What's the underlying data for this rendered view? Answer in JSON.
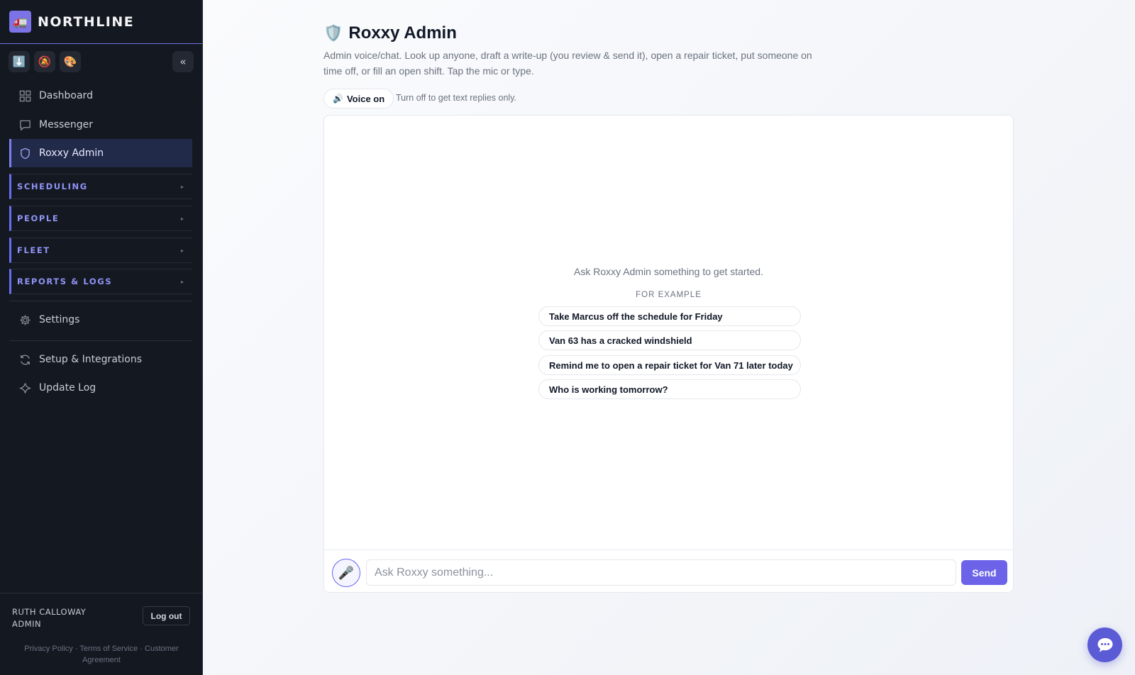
{
  "app": {
    "brand": "NORTHLINE",
    "brand_logo_icon": "truck-icon"
  },
  "sidebar": {
    "toolbar": [
      {
        "name": "download-icon",
        "glyph": "⬇️"
      },
      {
        "name": "notifications-off-icon",
        "glyph": "🔕"
      },
      {
        "name": "palette-icon",
        "glyph": "🎨"
      }
    ],
    "collapse_label": "«",
    "nav": [
      {
        "label": "Dashboard",
        "icon": "grid-icon"
      },
      {
        "label": "Messenger",
        "icon": "chat-bubble-icon"
      },
      {
        "label": "Roxxy Admin",
        "icon": "shield-icon",
        "active": true
      }
    ],
    "sections": [
      {
        "label": "SCHEDULING"
      },
      {
        "label": "PEOPLE"
      },
      {
        "label": "FLEET"
      },
      {
        "label": "REPORTS & LOGS"
      }
    ],
    "settings_label": "Settings",
    "bottom_nav": [
      {
        "label": "Setup & Integrations",
        "icon": "refresh-icon"
      },
      {
        "label": "Update Log",
        "icon": "sparkle-icon"
      }
    ],
    "user": {
      "name": "RUTH CALLOWAY",
      "role": "ADMIN",
      "logout_label": "Log out"
    },
    "footer": "Privacy Policy · Terms of Service · Customer Agreement"
  },
  "main": {
    "title": "Roxxy Admin",
    "description": "Admin voice/chat. Look up anyone, draft a write-up (you review & send it), open a repair ticket, put someone on time off, or fill an open shift. Tap the mic or type.",
    "voice_toggle_label": "Voice on",
    "voice_hint": "Turn off to get text replies only.",
    "chat": {
      "empty_message": "Ask Roxxy Admin something to get started.",
      "examples_heading": "FOR EXAMPLE",
      "examples": [
        "Take Marcus off the schedule for Friday",
        "Van 63 has a cracked windshield",
        "Remind me to open a repair ticket for Van 71 later today",
        "Who is working tomorrow?"
      ],
      "input_placeholder": "Ask Roxxy something...",
      "input_value": "",
      "send_label": "Send"
    }
  },
  "colors": {
    "sidebar_bg": "#141821",
    "accent": "#6c63e8",
    "section_label": "#8f93f5"
  }
}
